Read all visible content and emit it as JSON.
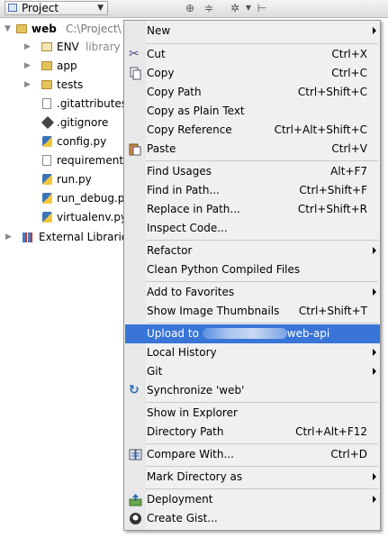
{
  "toolbar": {
    "combo_label": "Project"
  },
  "tree": {
    "root": {
      "name": "web",
      "path": "C:\\Project\\"
    },
    "items": [
      {
        "label": "ENV",
        "hint": "library"
      },
      {
        "label": "app"
      },
      {
        "label": "tests"
      },
      {
        "label": ".gitattributes"
      },
      {
        "label": ".gitignore"
      },
      {
        "label": "config.py"
      },
      {
        "label": "requirements"
      },
      {
        "label": "run.py"
      },
      {
        "label": "run_debug.py"
      },
      {
        "label": "virtualenv.py"
      }
    ],
    "external": "External Libraries"
  },
  "menu": {
    "new": "New",
    "new_sc": "",
    "cut": "Cut",
    "cut_sc": "Ctrl+X",
    "copy": "Copy",
    "copy_sc": "Ctrl+C",
    "copy_path": "Copy Path",
    "copy_path_sc": "Ctrl+Shift+C",
    "copy_plain": "Copy as Plain Text",
    "copy_ref": "Copy Reference",
    "copy_ref_sc": "Ctrl+Alt+Shift+C",
    "paste": "Paste",
    "paste_sc": "Ctrl+V",
    "find_usages": "Find Usages",
    "find_usages_sc": "Alt+F7",
    "find_in_path": "Find in Path...",
    "find_in_path_sc": "Ctrl+Shift+F",
    "replace_in_path": "Replace in Path...",
    "replace_in_path_sc": "Ctrl+Shift+R",
    "inspect": "Inspect Code...",
    "refactor": "Refactor",
    "clean": "Clean Python Compiled Files",
    "favorites": "Add to Favorites",
    "thumbnails": "Show Image Thumbnails",
    "thumbnails_sc": "Ctrl+Shift+T",
    "upload_prefix": "Upload to",
    "upload_suffix": "web-api",
    "local_history": "Local History",
    "git": "Git",
    "sync": "Synchronize 'web'",
    "explorer": "Show in Explorer",
    "dir_path": "Directory Path",
    "dir_path_sc": "Ctrl+Alt+F12",
    "compare": "Compare With...",
    "compare_sc": "Ctrl+D",
    "mark_dir": "Mark Directory as",
    "deployment": "Deployment",
    "gist": "Create Gist..."
  },
  "colors": {
    "selection": "#3875d7",
    "menu_bg": "#f0f0f0"
  }
}
